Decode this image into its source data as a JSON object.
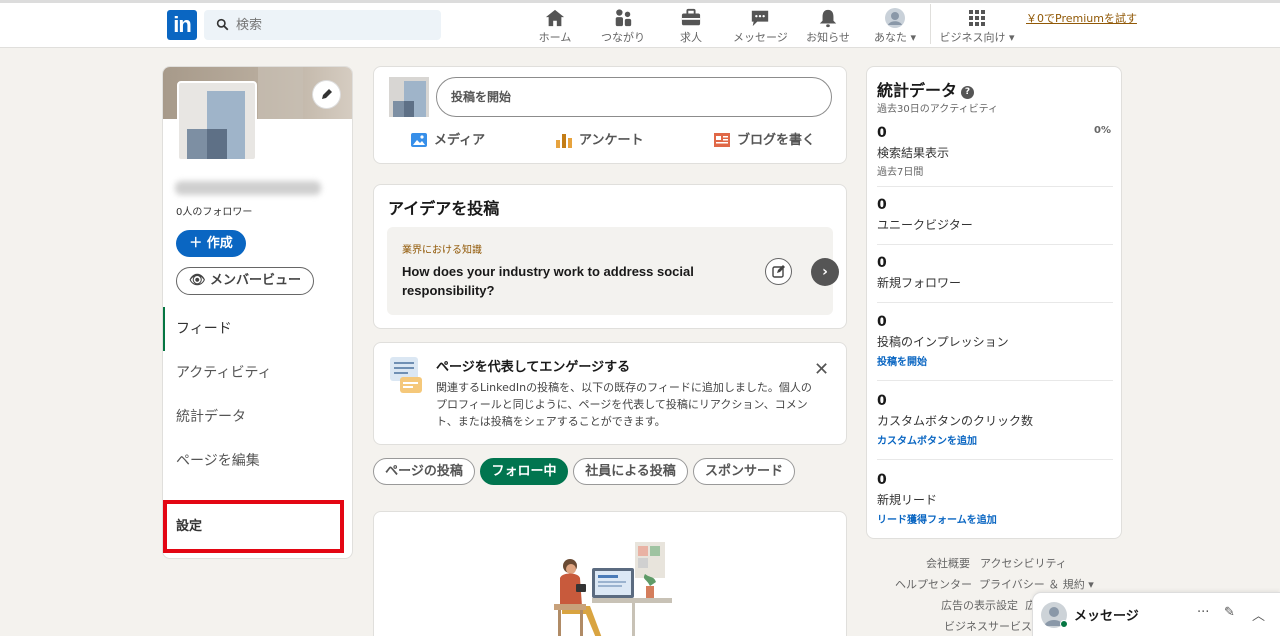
{
  "nav": {
    "logo": "in",
    "search_placeholder": "検索",
    "items": [
      {
        "label": "ホーム",
        "icon": "home-icon"
      },
      {
        "label": "つながり",
        "icon": "network-icon"
      },
      {
        "label": "求人",
        "icon": "briefcase-icon"
      },
      {
        "label": "メッセージ",
        "icon": "message-icon"
      },
      {
        "label": "お知らせ",
        "icon": "bell-icon"
      },
      {
        "label": "あなた ▾",
        "icon": "avatar-icon"
      },
      {
        "label": "ビジネス向け ▾",
        "icon": "grid-icon"
      }
    ],
    "premium": "￥0でPremiumを試す"
  },
  "profile": {
    "followers": "0人のフォロワー",
    "create_label": "＋ 作成",
    "member_view_label": "👁 メンバービュー",
    "links": [
      "フィード",
      "アクティビティ",
      "統計データ",
      "ページを編集"
    ],
    "settings": "設定"
  },
  "post_box": {
    "placeholder": "投稿を開始",
    "actions": [
      "メディア",
      "アンケート",
      "ブログを書く"
    ]
  },
  "idea": {
    "title": "アイデアを投稿",
    "tag": "業界における知識",
    "question": "How does your industry work to address social responsibility?"
  },
  "engage": {
    "title": "ページを代表してエンゲージする",
    "text": "関連するLinkedInの投稿を、以下の既存のフィードに追加しました。個人のプロフィールと同じように、ページを代表して投稿にリアクション、コメント、または投稿をシェアすることができます。"
  },
  "filters": [
    "ページの投稿",
    "フォロー中",
    "社員による投稿",
    "スポンサード"
  ],
  "filters_active": "フォロー中",
  "stats": {
    "title": "統計データ",
    "subtitle": "過去30日のアクティビティ",
    "items": [
      {
        "value": "0",
        "name": "検索結果表示",
        "note": "過去7日間",
        "pct": "0%"
      },
      {
        "value": "0",
        "name": "ユニークビジター"
      },
      {
        "value": "0",
        "name": "新規フォロワー"
      },
      {
        "value": "0",
        "name": "投稿のインプレッション",
        "link": "投稿を開始"
      },
      {
        "value": "0",
        "name": "カスタムボタンのクリック数",
        "link": "カスタムボタンを追加"
      },
      {
        "value": "0",
        "name": "新規リード",
        "link": "リード獲得フォームを追加"
      }
    ]
  },
  "footer": {
    "links": [
      "会社概要",
      "アクセシビリティ",
      "ヘルプセンター",
      "プライバシー ＆ 規約 ▾",
      "広告の表示設定",
      "広",
      "ビジネスサービス"
    ]
  },
  "messaging": {
    "label": "メッセージ",
    "actions": [
      "···",
      "✎",
      "︿"
    ]
  },
  "colors": {
    "brand": "#0a66c2",
    "active_green": "#01754f",
    "highlight_red": "#e30613"
  }
}
